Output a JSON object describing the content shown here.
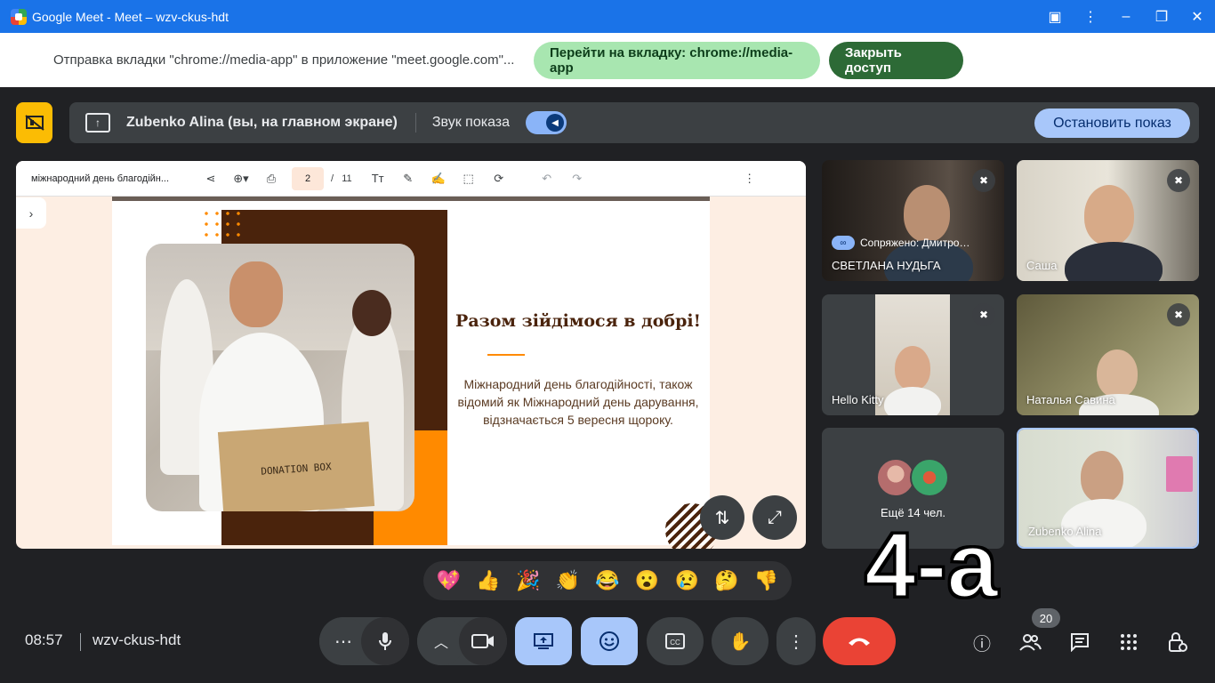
{
  "window": {
    "title": "Google Meet - Meet – wzv-ckus-hdt"
  },
  "share_notice": {
    "message": "Отправка вкладки \"chrome://media-app\" в приложение \"meet.google.com\"...",
    "switch_label": "Перейти на вкладку: chrome://media-app",
    "close_label": "Закрыть доступ"
  },
  "presentation": {
    "presenter": "Zubenko Alina (вы, на главном экране)",
    "audio_label": "Звук показа",
    "audio_on": true,
    "stop_label": "Остановить показ"
  },
  "pdf": {
    "doc_name": "міжнародний день благодійн...",
    "page": "2",
    "separator": "/",
    "total": "11"
  },
  "slide": {
    "box_text": "DONATION BOX",
    "title": "Разом зійдімося в добрі!",
    "body": "Міжнародний день благодійності, також відомий як Міжнародний день дарування, відзначається 5 вересня щороку."
  },
  "participants": [
    {
      "name": "СВЕТЛАНА НУДЬГА",
      "paired": "Сопряжено: Дмитро…",
      "muted": true
    },
    {
      "name": "Саша",
      "muted": true
    },
    {
      "name": "Hello Kitty",
      "muted": true
    },
    {
      "name": "Наталья Савина",
      "muted": true
    },
    {
      "name": "Zubenko Alina",
      "muted": false
    }
  ],
  "more_participants": "Ещё 14 чел.",
  "overlay_label": "4-а",
  "reactions": [
    "💖",
    "👍",
    "🎉",
    "👏",
    "😂",
    "😮",
    "😢",
    "🤔",
    "👎"
  ],
  "bottom": {
    "time": "08:57",
    "meeting_code": "wzv-ckus-hdt",
    "people_count": "20"
  },
  "colors": {
    "title_bar": "#1a73e8",
    "accent": "#a8c7fa",
    "end_call": "#ea4335",
    "present_warning": "#fbbc04"
  }
}
